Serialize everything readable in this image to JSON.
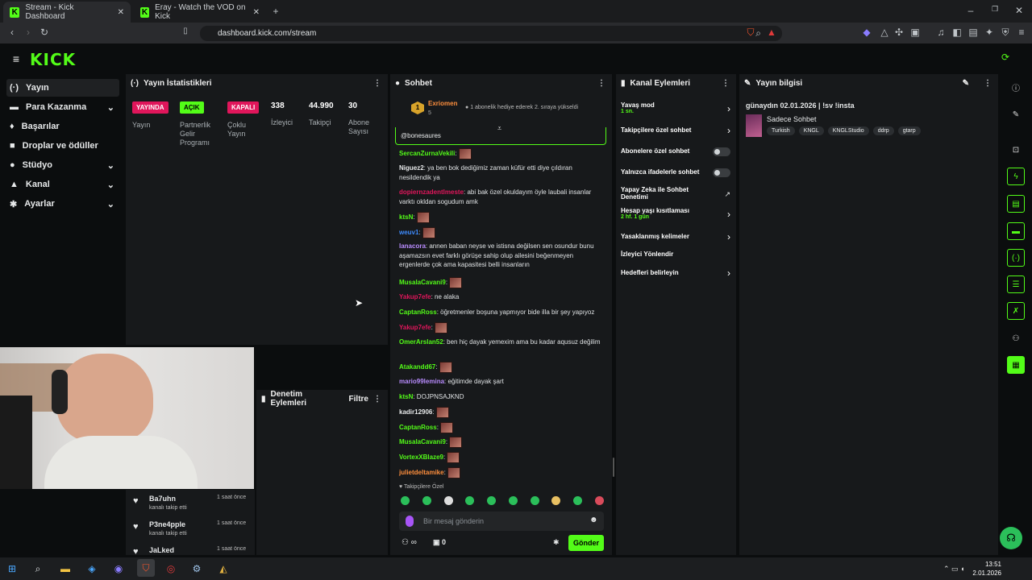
{
  "browser": {
    "tabs": [
      {
        "title": "Stream - Kick Dashboard"
      },
      {
        "title": "Eray - Watch the VOD on Kick"
      }
    ],
    "url": "dashboard.kick.com/stream"
  },
  "brand": {
    "logo": "KICK",
    "accent": "#53fc18"
  },
  "sidebar": {
    "items": [
      {
        "label": "Yayın",
        "icon": "broadcast-icon"
      },
      {
        "label": "Para Kazanma",
        "icon": "money-icon"
      },
      {
        "label": "Başarılar",
        "icon": "trophy-icon"
      },
      {
        "label": "Droplar ve ödüller",
        "icon": "gift-icon"
      },
      {
        "label": "Stüdyo",
        "icon": "studio-icon"
      },
      {
        "label": "Kanal",
        "icon": "user-icon"
      },
      {
        "label": "Ayarlar",
        "icon": "gear-icon"
      }
    ]
  },
  "stats": {
    "title": "Yayın İstatistikleri",
    "items": [
      {
        "pill": "YAYINDA",
        "label": "Yayın"
      },
      {
        "pill": "AÇIK",
        "label": "Partnerlik Gelir Programı"
      },
      {
        "pill": "KAPALI",
        "label": "Çoklu Yayın"
      }
    ],
    "numbers": [
      {
        "value": "338",
        "label": "İzleyici"
      },
      {
        "value": "44.990",
        "label": "Takipçi"
      },
      {
        "value": "30",
        "label": "Abone Sayısı"
      }
    ]
  },
  "moderation": {
    "title": "Denetim Eylemleri",
    "filter": "Filtre"
  },
  "follows": [
    {
      "name": "Ba7uhn",
      "text": "kanalı takip etti",
      "time": "1 saat önce"
    },
    {
      "name": "P3ne4pple",
      "text": "kanalı takip etti",
      "time": "1 saat önce"
    },
    {
      "name": "JaLked",
      "text": "",
      "time": "1 saat önce"
    }
  ],
  "chat": {
    "title": "Sohbet",
    "pinned_user": "Exriomen",
    "pinned_count": "5",
    "pinned_msg": "1 abonelik hediye ederek 2. sıraya yükseldi",
    "reply_to": "@bonesaures",
    "mode_label": "Takipçilere Özel",
    "placeholder": "Bir mesaj gönderin",
    "send": "Gönder",
    "viewers": "0",
    "messages": [
      {
        "user": "SercanZurnaVekili",
        "color": "#53fc18",
        "text": "",
        "emote": true
      },
      {
        "user": "Niguez2",
        "color": "#e7e9ea",
        "text": "ya ben bok dediğimiz zaman küfür etti diye çıldıran nesildendik ya",
        "emote": false
      },
      {
        "user": "dopiernzadentlmeste",
        "color": "#e0165b",
        "text": "abi bak özel okuldayım öyle laubali insanlar varktı okldan sogudum amk",
        "emote": false
      },
      {
        "user": "ktsN",
        "color": "#53fc18",
        "text": "",
        "emote": true
      },
      {
        "user": "weuv1",
        "color": "#3d8bfd",
        "text": "",
        "emote": true
      },
      {
        "user": "lanacora",
        "color": "#b98cff",
        "text": "annen baban neyse ve istisna değilsen sen osundur bunu aşamazsın evet farklı görüşe sahip olup ailesini beğenmeyen ergenlerde çok ama kapasitesi belli insanların",
        "emote": false
      },
      {
        "user": "MusalaCavani9",
        "color": "#53fc18",
        "text": "",
        "emote": true
      },
      {
        "user": "Yakup7efe",
        "color": "#e0165b",
        "text": "ne alaka",
        "emote": false
      },
      {
        "user": "CaptanRoss",
        "color": "#53fc18",
        "text": "öğretmenler boşuna yapmıyor bide illa bir şey yapıyoz",
        "emote": false
      },
      {
        "user": "Yakup7efe",
        "color": "#e0165b",
        "text": "",
        "emote": true
      },
      {
        "user": "OmerArslan52",
        "color": "#53fc18",
        "text": "ben hiç dayak yemexim ama bu kadar aqusuz değilim",
        "emote": false
      },
      {
        "user": "Atakandd67",
        "color": "#53fc18",
        "text": "",
        "emote": true
      },
      {
        "user": "mario99lemina",
        "color": "#b98cff",
        "text": "eğitimde dayak şart",
        "emote": false
      },
      {
        "user": "ktsN",
        "color": "#53fc18",
        "text": "DOJPNSAJKND",
        "emote": false
      },
      {
        "user": "kadir12906",
        "color": "#e7e9ea",
        "text": "",
        "emote": true
      },
      {
        "user": "CaptanRoss",
        "color": "#53fc18",
        "text": "",
        "emote": true
      },
      {
        "user": "MusalaCavani9",
        "color": "#53fc18",
        "text": "",
        "emote": true
      },
      {
        "user": "VortexXBlaze9",
        "color": "#53fc18",
        "text": "",
        "emote": true
      },
      {
        "user": "julietdeltamike",
        "color": "#ff8f3d",
        "text": "",
        "emote": true
      }
    ]
  },
  "channel_actions": {
    "title": "Kanal Eylemleri",
    "items": [
      {
        "label": "Yavaş mod",
        "sub": "1 sn.",
        "ctl": "chev"
      },
      {
        "label": "Takipçilere özel sohbet",
        "sub": "",
        "ctl": "chev"
      },
      {
        "label": "Abonelere özel sohbet",
        "sub": "",
        "ctl": "toggle"
      },
      {
        "label": "Yalnızca ifadelerle sohbet",
        "sub": "",
        "ctl": "toggle"
      },
      {
        "label": "Yapay Zeka ile Sohbet Denetimi",
        "sub": "",
        "ctl": "ext"
      },
      {
        "label": "Hesap yaşı kısıtlaması",
        "sub": "2 hf. 1 gün",
        "ctl": "chev"
      },
      {
        "label": "Yasaklanmış kelimeler",
        "sub": "",
        "ctl": "chev"
      },
      {
        "label": "İzleyici Yönlendir",
        "sub": "",
        "ctl": ""
      },
      {
        "label": "Hedefleri belirleyin",
        "sub": "",
        "ctl": "chev"
      }
    ]
  },
  "stream_info": {
    "title": "Yayın bilgisi",
    "stream_title": "günaydın 02.01.2026 | !sv !insta",
    "category": "Sadece Sohbet",
    "tags": [
      "Turkish",
      "KNGL",
      "KNGLStudio",
      "ddrp",
      "gtarp"
    ]
  },
  "taskbar": {
    "time": "13:51",
    "date": "2.01.2026"
  }
}
